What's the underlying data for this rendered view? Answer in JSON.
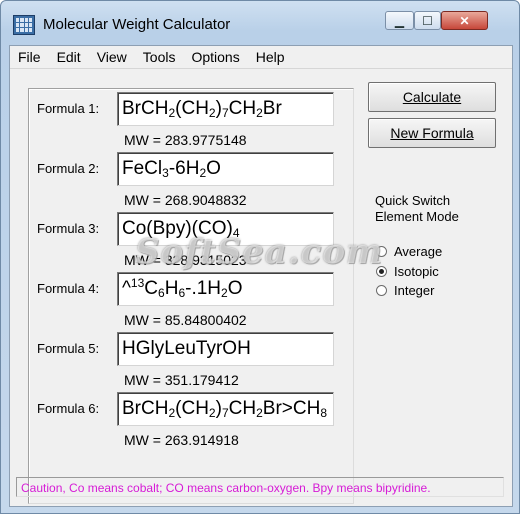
{
  "window": {
    "title": "Molecular Weight Calculator",
    "icon": "calculator-grid-icon",
    "controls": {
      "minimize": "▁",
      "maximize": "☐",
      "close": "✕"
    }
  },
  "menu": [
    "File",
    "Edit",
    "View",
    "Tools",
    "Options",
    "Help"
  ],
  "formulas": [
    {
      "label": "Formula 1:",
      "mw": "MW = 283.9775148"
    },
    {
      "label": "Formula 2:",
      "mw": "MW = 268.9048832"
    },
    {
      "label": "Formula 3:",
      "mw": "MW = 328.9315023"
    },
    {
      "label": "Formula 4:",
      "mw": "MW = 85.84800402"
    },
    {
      "label": "Formula 5:",
      "mw": "MW = 351.179412"
    },
    {
      "label": "Formula 6:",
      "mw": "MW = 263.914918"
    }
  ],
  "formula_text": {
    "f1": [
      "BrCH",
      "2",
      "(CH",
      "2",
      ")",
      "7",
      "CH",
      "2",
      "Br"
    ],
    "f2": [
      "FeCl",
      "3",
      "-6H",
      "2",
      "O"
    ],
    "f3": [
      "Co(Bpy)(CO)",
      "4"
    ],
    "f4": [
      "^",
      "13",
      "C",
      "6",
      "H",
      "6",
      "-.1H",
      "2",
      "O"
    ],
    "f5": [
      "HGlyLeuTyrOH"
    ],
    "f6": [
      "BrCH",
      "2",
      "(CH",
      "2",
      ")",
      "7",
      "CH",
      "2",
      "Br>CH",
      "8"
    ]
  },
  "buttons": {
    "calculate": "Calculate",
    "new_formula": "New Formula"
  },
  "quick_switch": {
    "line1": "Quick Switch",
    "line2": "Element Mode",
    "options": [
      "Average",
      "Isotopic",
      "Integer"
    ],
    "selected": "Isotopic"
  },
  "status": "Caution, Co means cobalt; CO means carbon-oxygen.  Bpy means bipyridine.",
  "watermark": "SoftSea.com",
  "colors": {
    "status_text": "#d61bd6",
    "title_bar": "#c5d8ec",
    "close_button": "#c7473a"
  }
}
